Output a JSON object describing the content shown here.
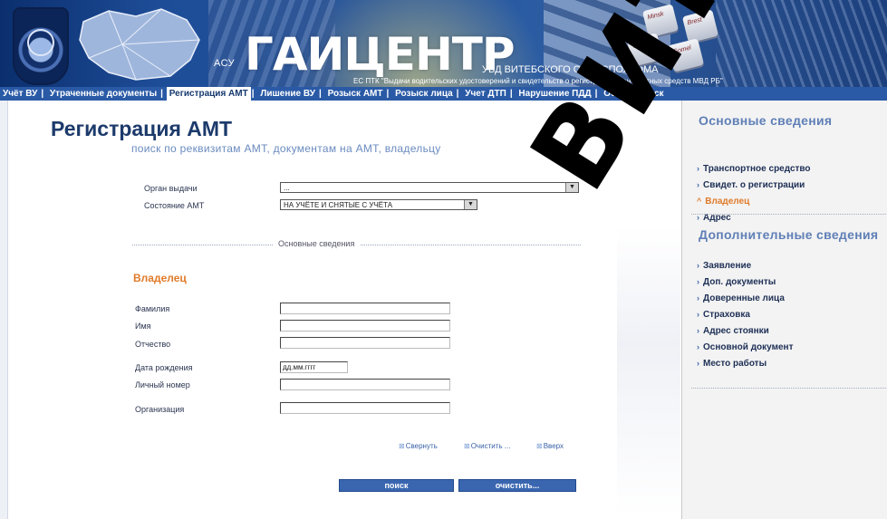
{
  "header": {
    "asu": "АСУ",
    "logo": "ГАИЦЕНТР",
    "org": "УВД ВИТЕБСКОГО ОБЛИСПОЛКОМА",
    "system": "ЕС ПТК \"Выдачи водительских удостоверений и свидетельств о регистрации транспортных средств МВД РБ\"",
    "keys": [
      "Minsk",
      "Brest",
      "Gomel",
      "Vitebsk"
    ]
  },
  "nav": {
    "items": [
      {
        "label": "Учёт ВУ"
      },
      {
        "label": "Утраченные документы"
      },
      {
        "label": "Регистрация АМТ",
        "active": true
      },
      {
        "label": "Лишение ВУ"
      },
      {
        "label": "Розыск АМТ"
      },
      {
        "label": "Розыск лица"
      },
      {
        "label": "Учет ДТП"
      },
      {
        "label": "Нарушение ПДД"
      },
      {
        "label": "Общий поиск"
      }
    ]
  },
  "main": {
    "title": "Регистрация АМТ",
    "subtitle": "поиск по реквизитам АМТ, документам на АМТ, владельцу",
    "filters": {
      "organ_label": "Орган выдачи",
      "organ_value": "...",
      "state_label": "Состояние АМТ",
      "state_value": "НА УЧЁТЕ И СНЯТЫЕ С УЧЁТА"
    },
    "divider_label": "Основные сведения",
    "section_title": "Владелец",
    "fields": {
      "surname_label": "Фамилия",
      "name_label": "Имя",
      "patronymic_label": "Отчество",
      "dob_label": "Дата рождения",
      "dob_placeholder": "дд.мм.гггг",
      "personal_no_label": "Личный номер",
      "organization_label": "Организация"
    },
    "tools": {
      "collapse": "Свернуть",
      "clear": "Очистить ...",
      "up": "Вверх"
    },
    "buttons": {
      "search": "поиск",
      "clear": "очистить..."
    }
  },
  "sidebar": {
    "basic_title": "Основные сведения",
    "basic_items": [
      {
        "label": "Транспортное средство"
      },
      {
        "label": "Свидет. о регистрации"
      },
      {
        "label": "Владелец",
        "active": true
      },
      {
        "label": "Адрес"
      }
    ],
    "extra_title": "Дополнительные сведения",
    "extra_items": [
      {
        "label": "Заявление"
      },
      {
        "label": "Доп. документы"
      },
      {
        "label": "Доверенные лица"
      },
      {
        "label": "Страховка"
      },
      {
        "label": "Адрес стоянки"
      },
      {
        "label": "Основной документ"
      },
      {
        "label": "Место работы"
      }
    ]
  },
  "watermark": "ВИТЕБСКИЙ",
  "colors": {
    "nav_bg": "#2a5aa6",
    "title": "#1c3a6b",
    "accent_orange": "#e07b2a",
    "button": "#3a66b0"
  }
}
